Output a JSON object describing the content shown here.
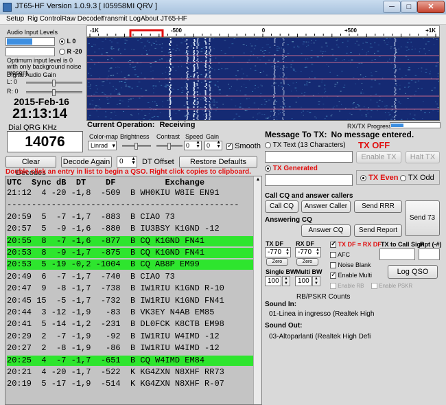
{
  "window": {
    "title": "JT65-HF Version 1.0.9.3  [ I05958MI QRV ]",
    "min": "─",
    "max": "□",
    "close": "✕"
  },
  "menu": [
    "Setup",
    "Rig Control",
    "Raw Decoder",
    "Transmit Log",
    "About JT65-HF"
  ],
  "audio": {
    "title": "Audio Input Levels",
    "l_label": "L 0",
    "r_label": "R -20",
    "note": "Optimum input level is 0 with only background noise present.",
    "gain_label": "Digital Audio Gain",
    "gain_l": "L: 0",
    "gain_r": "R: 0",
    "level_l": 0.53
  },
  "clock": {
    "date": "2015-Feb-16",
    "time": "21:13:14",
    "qrg_label": "Dial QRG KHz",
    "qrg": "14076"
  },
  "spectrum": {
    "ticks": [
      "-1K",
      "-500",
      "0",
      "+500",
      "+1K"
    ],
    "rxtx_label": "RX/TX Progress"
  },
  "operation": {
    "label": "Current Operation:",
    "value": "Receiving"
  },
  "controls": {
    "colormap_label": "Color-map",
    "colormap_value": "Linrad",
    "brightness_label": "Brightness",
    "contrast_label": "Contrast",
    "speed_label": "Speed",
    "speed_value": "0",
    "gain_label": "Gain",
    "gain_value": "0",
    "smooth_label": "Smooth"
  },
  "buttons": {
    "clear_decodes": "Clear Decodes",
    "decode_again": "Decode Again",
    "dt_offset_value": "0",
    "dt_offset_label": "DT Offset",
    "restore_defaults": "Restore Defaults"
  },
  "hint": "Double click an entry in list to begin a QSO.  Right click copies to clipboard.",
  "list": {
    "header": "UTC  Sync dB  DT    DF          Exchange",
    "rows": [
      {
        "t": "21:12  4 -20 -1,8  -509  B WH0KIU W8IE EN91",
        "hl": false
      },
      {
        "t": "-----------------------------------------------",
        "hl": false
      },
      {
        "t": "20:59  5  -7 -1,7  -883  B CIAO 73",
        "hl": false
      },
      {
        "t": "20:57  5  -9 -1,6  -880  B IU3BSY K1GND -12",
        "hl": false
      },
      {
        "t": "20:55  8  -7 -1,6  -877  B CQ K1GND FN41",
        "hl": true
      },
      {
        "t": "20:53  8  -9 -1,7  -875  B CQ K1GND FN41",
        "hl": true
      },
      {
        "t": "20:53  5 -19 -0,2 -1004  B CQ AB8P EM99",
        "hl": true
      },
      {
        "t": "20:49  6  -7 -1,7  -740  B CIAO 73",
        "hl": false
      },
      {
        "t": "20:47  9  -8 -1,7  -738  B IW1RIU K1GND R-10",
        "hl": false
      },
      {
        "t": "20:45 15  -5 -1,7  -732  B IW1RIU K1GND FN41",
        "hl": false
      },
      {
        "t": "20:44  3 -12 -1,9   -83  B VK3EY N4AB EM85",
        "hl": false
      },
      {
        "t": "20:41  5 -14 -1,2  -231  B DL0FCK K8CTB EM98",
        "hl": false
      },
      {
        "t": "20:29  2  -7 -1,9   -92  B IW1RIU W4IMD -12",
        "hl": false
      },
      {
        "t": "20:27  2  -8 -1,9   -86  B IW1RIU W4IMD -12",
        "hl": false
      },
      {
        "t": "20:25  4  -7 -1,7  -651  B CQ W4IMD EM84",
        "hl": true
      },
      {
        "t": "20:21  4 -20 -1,7  -522  K KG4ZXN N8XHF RR73",
        "hl": false
      },
      {
        "t": "20:19  5 -17 -1,9  -514  K KG4ZXN N8XHF R-07",
        "hl": false
      }
    ]
  },
  "tx": {
    "message_label": "Message To TX:",
    "message_value": "No message entered.",
    "tx_text_label": "TX Text (13 Characters)",
    "tx_off": "TX OFF",
    "enable_tx": "Enable TX",
    "halt_tx": "Halt TX",
    "tx_generated": "TX Generated",
    "tx_even": "TX Even",
    "tx_odd": "TX Odd",
    "call_cq_group": "Call CQ and answer callers",
    "call_cq": "Call CQ",
    "answer_caller": "Answer Caller",
    "send_rrr": "Send RRR",
    "answering_cq_group": "Answering CQ",
    "answer_cq": "Answer CQ",
    "send_report": "Send Report",
    "send_73": "Send 73",
    "tx_df_label": "TX DF",
    "tx_df_value": "-770",
    "rx_df_label": "RX DF",
    "rx_df_value": "-770",
    "zero": "Zero",
    "txdf_eq_rxdf": "TX DF = RX DF",
    "afc": "AFC",
    "noise_blank": "Noise Blank",
    "enable_multi": "Enable Multi",
    "enable_rb": "Enable RB",
    "enable_pskr": "Enable PSKR",
    "tx_to_call_label": "TX to Call Sign",
    "rpt_label": "Rpt (-#)",
    "single_bw_label": "Single BW",
    "single_bw_value": "100",
    "multi_bw_label": "Multi BW",
    "multi_bw_value": "100",
    "log_qso": "Log QSO",
    "rb_counts": "RB/PSKR Counts",
    "sound_in_label": "Sound In:",
    "sound_in_value": "01-Linea in ingresso (Realtek High",
    "sound_out_label": "Sound Out:",
    "sound_out_value": "03-Altoparlanti (Realtek High Defi"
  },
  "colors": {
    "tx_off": "#e01010",
    "highlight": "#2ee52e",
    "hint": "#e01010",
    "waterfall": "#152a73"
  }
}
